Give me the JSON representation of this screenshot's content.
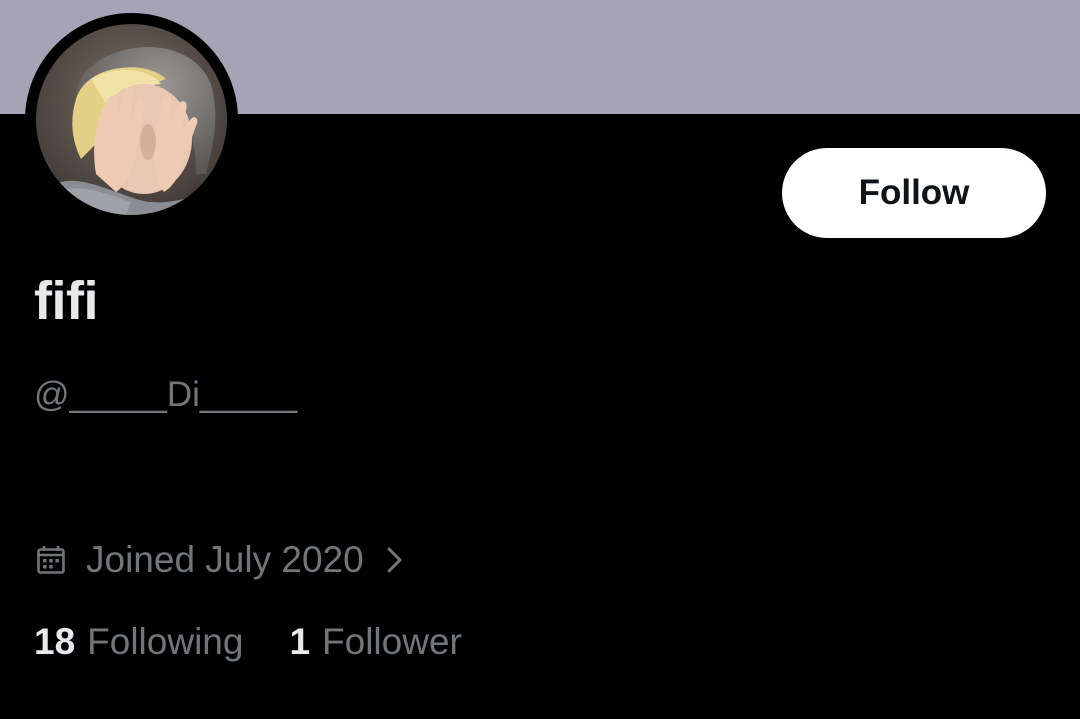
{
  "colors": {
    "banner": "#a7a3b7",
    "background": "#000000",
    "primary_text": "#e7e9ea",
    "secondary_text": "#71767b",
    "follow_button_bg": "#ffffff",
    "follow_button_text": "#0f1419"
  },
  "profile": {
    "display_name": "fifi",
    "handle": "@_____Di_____",
    "joined": "Joined July 2020",
    "joined_icon": "calendar-icon",
    "joined_chevron_icon": "chevron-right-icon",
    "avatar_icon": "profile-avatar"
  },
  "actions": {
    "follow_label": "Follow"
  },
  "stats": {
    "following_count": "18",
    "following_label": "Following",
    "followers_count": "1",
    "followers_label": "Follower"
  }
}
